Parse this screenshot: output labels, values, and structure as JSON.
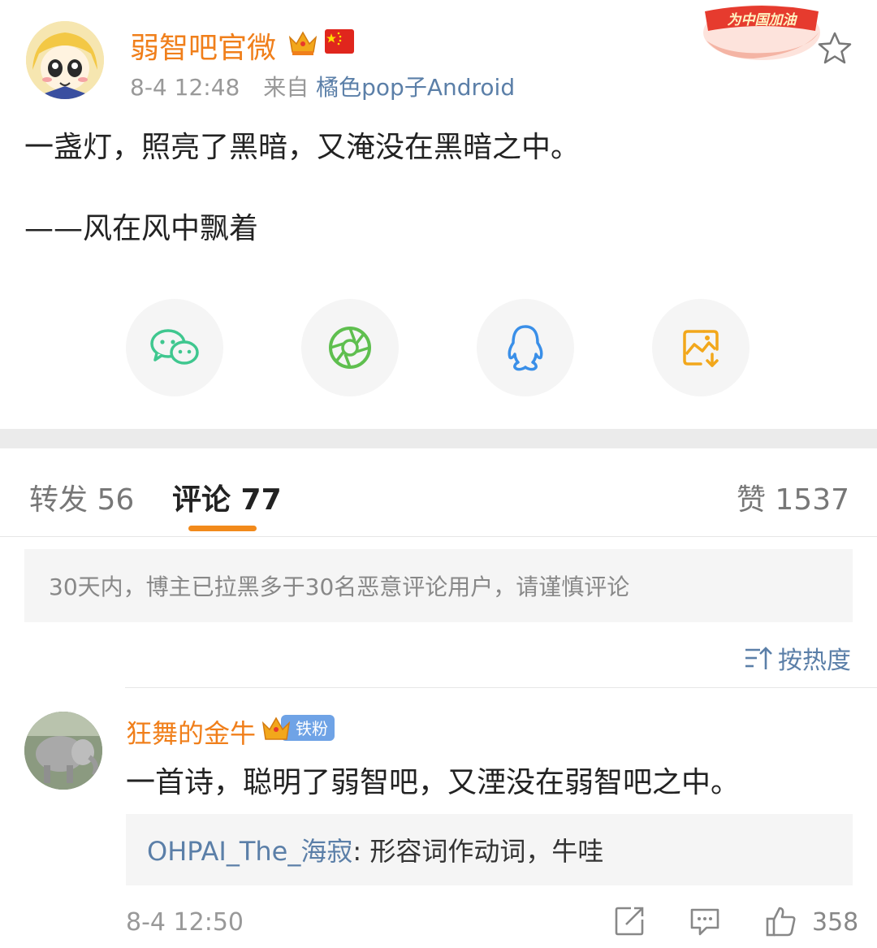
{
  "post": {
    "author": "弱智吧官微",
    "time": "8-4 12:48",
    "source_prefix": "来自",
    "source": "橘色pop子Android",
    "badge_text": "为中国加油",
    "line1": "一盏灯，照亮了黑暗，又淹没在黑暗之中。",
    "line2": "——风在风中飘着"
  },
  "share": {
    "items": [
      {
        "icon": "wechat-icon",
        "color": "#3fc78f"
      },
      {
        "icon": "moments-icon",
        "color": "#5fbf4f"
      },
      {
        "icon": "qq-icon",
        "color": "#3a8fe8"
      },
      {
        "icon": "save-image-icon",
        "color": "#f2a71b"
      }
    ]
  },
  "tabs": {
    "repost": "转发 56",
    "comment": "评论 77",
    "like": "赞 1537"
  },
  "notice": "30天内，博主已拉黑多于30名恶意评论用户，请谨慎评论",
  "sort_label": "按热度",
  "comment": {
    "author": "狂舞的金牛",
    "badge": "铁粉",
    "text": "一首诗，聪明了弱智吧，又湮没在弱智吧之中。",
    "reply_user": "OHPAI_The_海寂",
    "reply_text": ": 形容词作动词，牛哇",
    "time": "8-4 12:50",
    "like_count": "358"
  },
  "colors": {
    "accent": "#f28a1b",
    "name": "#f07f1b",
    "link": "#5b7fa8"
  }
}
